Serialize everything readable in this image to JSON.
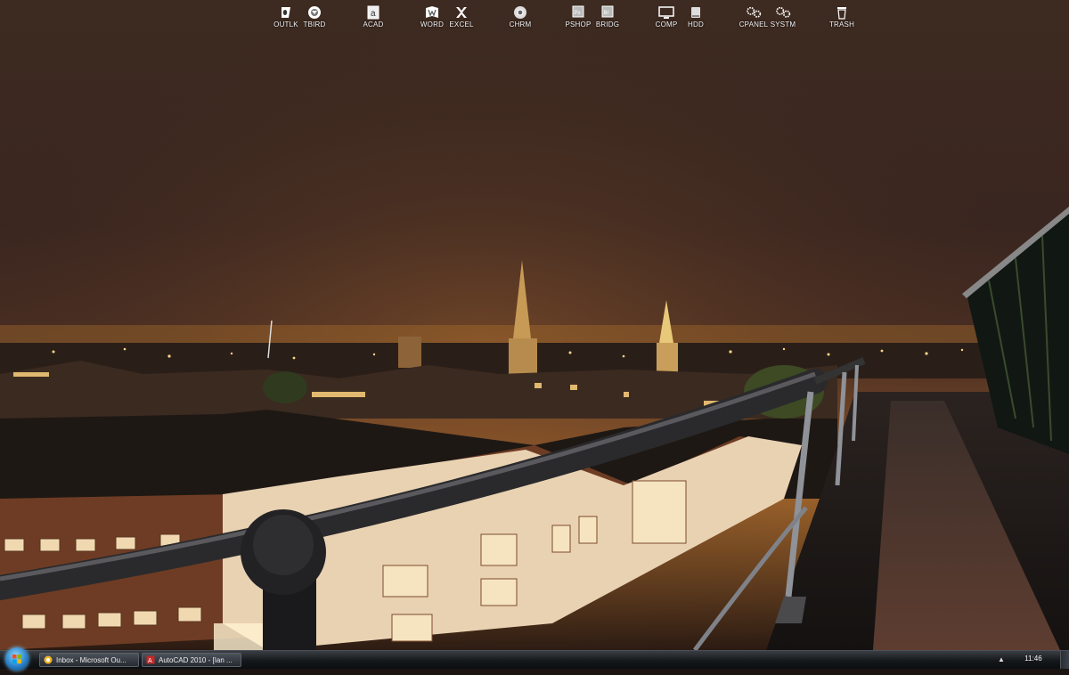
{
  "desktop": {
    "dock_icons": [
      {
        "label": "OUTLK",
        "icon": "outlook-icon"
      },
      {
        "label": "TBIRD",
        "icon": "thunderbird-icon"
      },
      {
        "label": "ACAD",
        "icon": "autocad-icon"
      },
      {
        "label": "WORD",
        "icon": "word-icon"
      },
      {
        "label": "EXCEL",
        "icon": "excel-icon"
      },
      {
        "label": "CHRM",
        "icon": "chrome-icon"
      },
      {
        "label": "PSHOP",
        "icon": "photoshop-icon"
      },
      {
        "label": "BRIDG",
        "icon": "bridge-icon"
      },
      {
        "label": "COMP",
        "icon": "computer-icon"
      },
      {
        "label": "HDD",
        "icon": "hard-drive-icon"
      },
      {
        "label": "CPANEL",
        "icon": "gears-icon"
      },
      {
        "label": "SYSTM",
        "icon": "gears-icon"
      },
      {
        "label": "TRASH",
        "icon": "trash-icon"
      }
    ],
    "wallpaper": "night-city-rooftop-photo"
  },
  "taskbar": {
    "start_button": "windows-orb-icon",
    "tasks": [
      {
        "label": "Inbox - Microsoft Ou...",
        "icon": "outlook-icon"
      },
      {
        "label": "AutoCAD 2010 - [Ian ...",
        "icon": "autocad-icon"
      }
    ],
    "tray_arrow": "▲",
    "clock": "11:46"
  },
  "colors": {
    "sky_top": "#3e2a1f",
    "sky_glow": "#7a4a25",
    "taskbar": "#15181b",
    "icon_text": "#f2f2f2"
  }
}
